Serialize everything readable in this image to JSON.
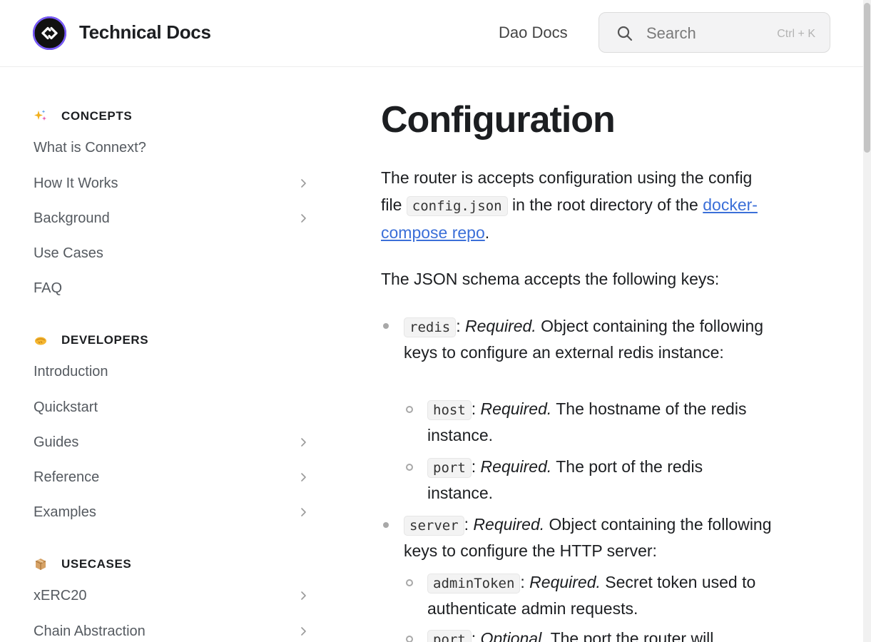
{
  "header": {
    "site_title": "Technical Docs",
    "nav_link": "Dao Docs",
    "search_placeholder": "Search",
    "search_shortcut": "Ctrl + K"
  },
  "sidebar": {
    "sections": [
      {
        "icon": "sparkles-icon",
        "title": "CONCEPTS",
        "items": [
          {
            "label": "What is Connext?",
            "expandable": false
          },
          {
            "label": "How It Works",
            "expandable": true
          },
          {
            "label": "Background",
            "expandable": true
          },
          {
            "label": "Use Cases",
            "expandable": false
          },
          {
            "label": "FAQ",
            "expandable": false
          }
        ]
      },
      {
        "icon": "handshake-icon",
        "title": "DEVELOPERS",
        "items": [
          {
            "label": "Introduction",
            "expandable": false
          },
          {
            "label": "Quickstart",
            "expandable": false
          },
          {
            "label": "Guides",
            "expandable": true
          },
          {
            "label": "Reference",
            "expandable": true
          },
          {
            "label": "Examples",
            "expandable": true
          }
        ]
      },
      {
        "icon": "package-icon",
        "title": "USECASES",
        "items": [
          {
            "label": "xERC20",
            "expandable": true
          },
          {
            "label": "Chain Abstraction",
            "expandable": true
          }
        ]
      }
    ]
  },
  "content": {
    "title": "Configuration",
    "intro": {
      "part1": "The router is accepts configuration using the config file ",
      "code": "config.json",
      "part2": " in the root directory of the ",
      "link": "docker-compose repo",
      "part3": "."
    },
    "schema_intro": "The JSON schema accepts the following keys:",
    "keys": [
      {
        "key": "redis",
        "required": "Required.",
        "desc": " Object containing the following keys to configure an external redis instance:",
        "children": [
          {
            "key": "host",
            "required": "Required.",
            "desc": " The hostname of the redis instance."
          },
          {
            "key": "port",
            "required": "Required.",
            "desc": " The port of the redis instance."
          }
        ]
      },
      {
        "key": "server",
        "required": "Required.",
        "desc": " Object containing the following keys to configure the HTTP server:",
        "children": [
          {
            "key": "adminToken",
            "required": "Required.",
            "desc": " Secret token used to authenticate admin requests."
          },
          {
            "key": "port",
            "required": "Optional.",
            "desc": " The port the router will"
          }
        ]
      }
    ]
  },
  "colors": {
    "link": "#3b6fd8",
    "text": "#1c1e21",
    "muted": "#555a60"
  }
}
